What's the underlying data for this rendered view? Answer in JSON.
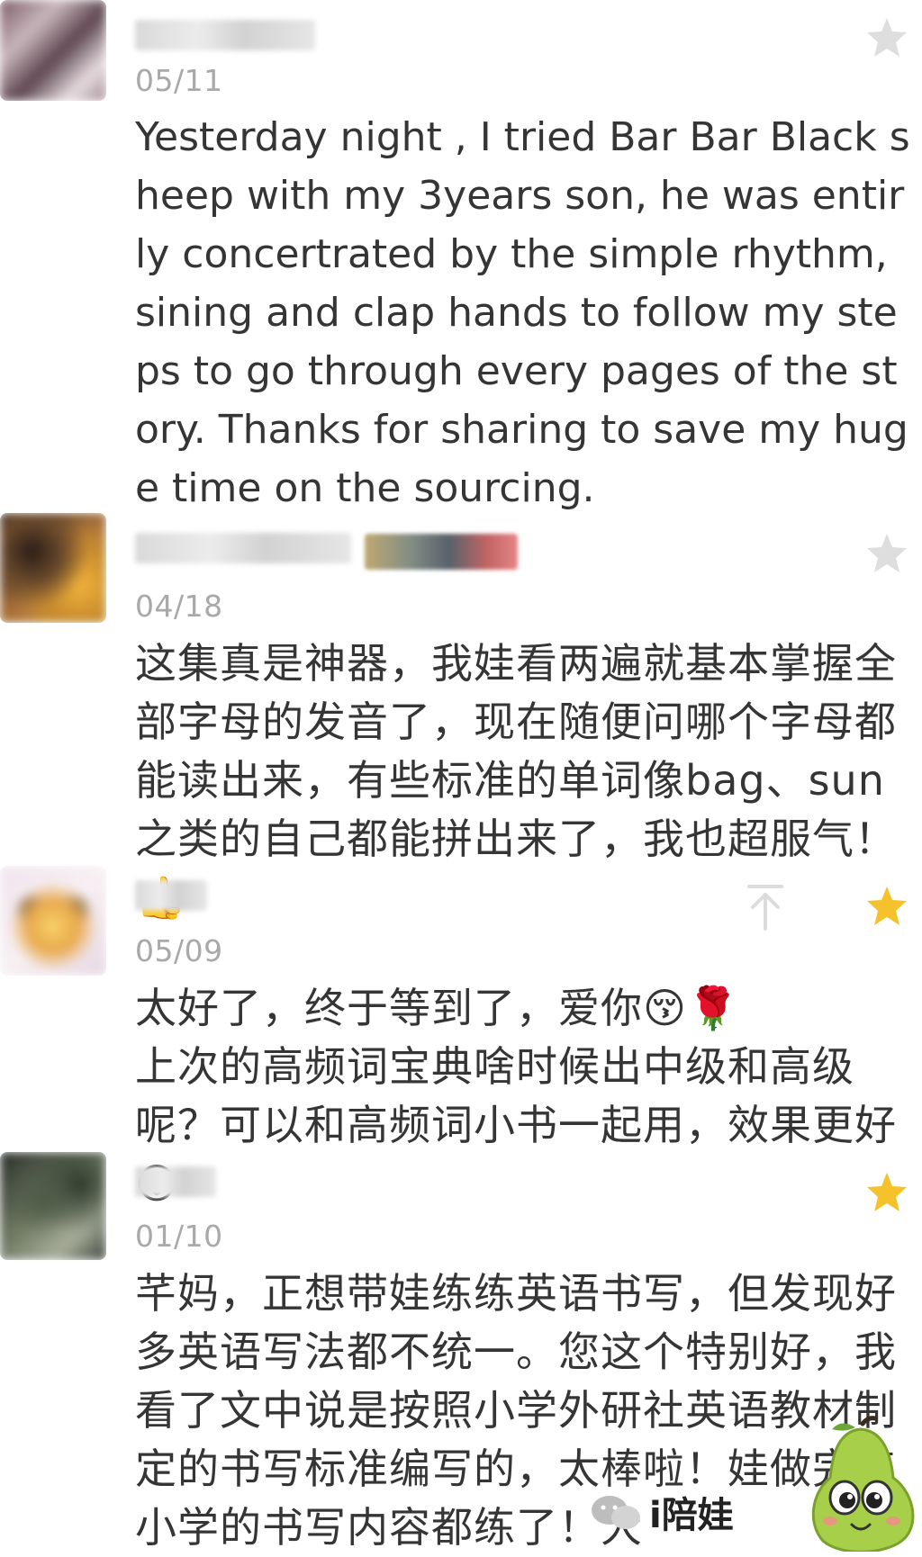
{
  "comments": [
    {
      "date": "05/11",
      "text": "Yesterday night , I tried Bar Bar Black sheep with my 3years son, he was entirly concertrated by the simple rhythm, sining and clap hands to follow my steps to go through every pages of the story. Thanks for sharing to save my huge time on the sourcing.",
      "starred": false
    },
    {
      "date": "04/18",
      "text": "这集真是神器，我娃看两遍就基本掌握全部字母的发音了，现在随便问哪个字母都能读出来，有些标准的单词像bag、sun之类的自己都能拼出来了，我也超服气！",
      "trailing_emoji": "👍",
      "starred": false
    },
    {
      "date": "05/09",
      "text_line1": "太好了，终于等到了，爱你",
      "line1_emojis": "😚🌹",
      "text_rest": "上次的高频词宝典啥时候出中级和高级呢？可以和高频词小书一起用，效果更好",
      "trailing_emoji": "😜",
      "starred": true,
      "pinned": true
    },
    {
      "date": "01/10",
      "text": "芊妈，正想带娃练练英语书写，但发现好多英语写法都不统一。您这个特别好，我看了文中说是按照小学外研社英语教材制定的书写标准编写的，太棒啦！娃做完连小学的书写内容都练了！大",
      "starred": true
    }
  ],
  "watermark": {
    "text": "i陪娃"
  },
  "icons": {
    "star_inactive": "star-outline-icon",
    "star_active": "star-filled-icon",
    "pin": "pin-top-icon",
    "mascot": "pear-mascot-icon"
  },
  "colors": {
    "star_active": "#f5c22b",
    "star_inactive": "#dedede",
    "date": "#a9a9a9",
    "text": "#353535"
  }
}
